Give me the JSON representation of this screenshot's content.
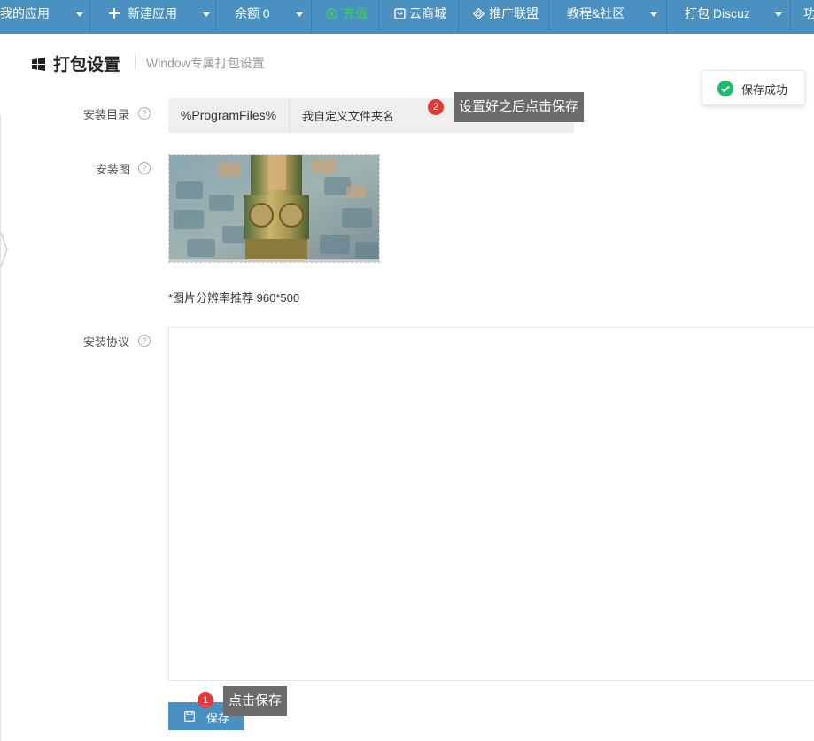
{
  "topnav": {
    "items": [
      {
        "label": "我的应用",
        "caret": true
      },
      {
        "label": "新建应用",
        "icon": "plus-icon",
        "caret": true
      },
      {
        "label": "余额 0",
        "caret": true
      },
      {
        "label": "充值",
        "icon": "yuan-circle-icon",
        "color": "#3bd15a"
      },
      {
        "label": "云商城",
        "icon": "shopping-bag-icon"
      },
      {
        "label": "推广联盟",
        "icon": "diamond-icon"
      },
      {
        "label": "教程&社区",
        "caret": true
      },
      {
        "label": "打包 Discuz",
        "caret": true
      },
      {
        "label": "功"
      }
    ]
  },
  "header": {
    "title": "打包设置",
    "subtitle": "Window专属打包设置",
    "icon": "windows-icon"
  },
  "toast": {
    "message": "保存成功",
    "icon": "check-circle-icon"
  },
  "form": {
    "install_dir": {
      "label": "安装目录",
      "prefix": "%ProgramFiles%",
      "value": "我自定义文件夹名"
    },
    "install_image": {
      "label": "安装图",
      "note": "*图片分辨率推荐 960*500"
    },
    "agreement": {
      "label": "安装协议"
    },
    "help_glyph": "?"
  },
  "annotations": [
    {
      "number": "2",
      "text": "设置好之后点击保存"
    },
    {
      "number": "1",
      "text": "点击保存"
    }
  ],
  "save_button": {
    "label": "保存",
    "icon": "save-icon"
  },
  "colors": {
    "nav_bg": "#4a90c0",
    "accent_green": "#3bd15a",
    "badge_red": "#e53935",
    "tooltip_bg": "#6b6b6b"
  }
}
